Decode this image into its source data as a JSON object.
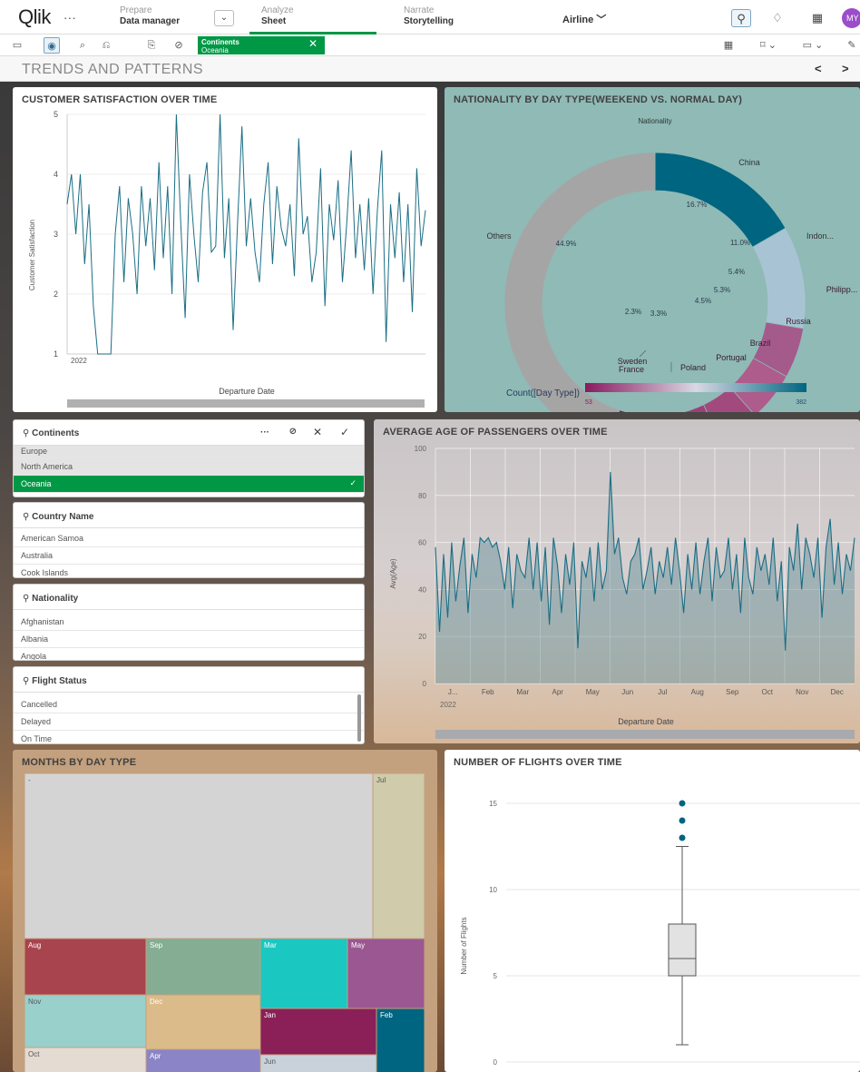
{
  "topbar": {
    "logo": "Qlik",
    "menu_dots": "···",
    "prepare_label": "Prepare",
    "prepare_value": "Data manager",
    "analyze_label": "Analyze",
    "analyze_value": "Sheet",
    "narrate_label": "Narrate",
    "narrate_value": "Storytelling",
    "app_name": "Airline",
    "avatar": "MY"
  },
  "selection": {
    "field": "Continents",
    "value": "Oceania"
  },
  "sheet": {
    "title": "TRENDS AND PATTERNS"
  },
  "panels": {
    "satisfaction": {
      "title": "CUSTOMER SATISFACTION OVER TIME",
      "ylabel": "Customer Satisfaction",
      "xlabel": "Departure Date",
      "x_tick": "2022",
      "y_ticks": [
        "1",
        "2",
        "3",
        "4",
        "5"
      ]
    },
    "nationality": {
      "title": "NATIONALITY BY DAY TYPE(WEEKEND VS. NORMAL DAY)",
      "legend_title": "Nationality",
      "color_legend": "Count([Day Type])",
      "color_min": "53",
      "color_max": "382"
    },
    "age": {
      "title": "AVERAGE AGE OF PASSENGERS OVER TIME",
      "ylabel": "Avg(Age)",
      "xlabel": "Departure Date",
      "year": "2022",
      "x_ticks": [
        "J...",
        "Feb",
        "Mar",
        "Apr",
        "May",
        "Jun",
        "Jul",
        "Aug",
        "Sep",
        "Oct",
        "Nov",
        "Dec"
      ],
      "y_ticks": [
        "0",
        "20",
        "40",
        "60",
        "80",
        "100"
      ]
    },
    "months": {
      "title": "MONTHS BY DAY TYPE"
    },
    "flights": {
      "title": "NUMBER OF FLIGHTS OVER TIME",
      "ylabel": "Number of Flights",
      "y_ticks": [
        "0",
        "5",
        "10",
        "15"
      ]
    }
  },
  "listboxes": {
    "continents": {
      "title": "Continents",
      "items": [
        "Europe",
        "North America",
        "Oceania"
      ]
    },
    "country": {
      "title": "Country Name",
      "items": [
        "American Samoa",
        "Australia",
        "Cook Islands"
      ]
    },
    "nationality": {
      "title": "Nationality",
      "items": [
        "Afghanistan",
        "Albania",
        "Angola"
      ]
    },
    "flight_status": {
      "title": "Flight Status",
      "items": [
        "Cancelled",
        "Delayed",
        "On Time"
      ]
    }
  },
  "colors": {
    "accent": "#009845",
    "line": "#1a6e85",
    "donut_high": "#006580",
    "donut_low": "#8a1a5e"
  },
  "chart_data": [
    {
      "type": "line",
      "title": "CUSTOMER SATISFACTION OVER TIME",
      "xlabel": "Departure Date",
      "ylabel": "Customer Satisfaction",
      "ylim": [
        1,
        5
      ],
      "values": [
        3.5,
        4,
        3,
        4,
        2.5,
        3.5,
        1.8,
        1,
        1,
        1,
        1,
        3,
        3.8,
        2.2,
        3.6,
        3,
        2,
        3.8,
        2.8,
        3.6,
        2.4,
        4.2,
        2.6,
        3.8,
        2,
        5,
        3.2,
        1.6,
        4,
        3,
        2.2,
        3.7,
        4.2,
        2.7,
        2.8,
        5,
        2.6,
        3.6,
        1.4,
        3.2,
        4.8,
        2.8,
        3.6,
        2.7,
        2.2,
        3.5,
        4.2,
        2.5,
        3.8,
        3.1,
        2.8,
        3.5,
        2.3,
        4.6,
        3,
        3.3,
        2.2,
        2.7,
        4.1,
        1.8,
        3.5,
        2.9,
        3.9,
        2.2,
        3.2,
        4.4,
        2.6,
        3.5,
        2.4,
        3.6,
        2,
        3.4,
        4.4,
        1.2,
        3.5,
        2.6,
        3.7,
        2.2,
        3.5,
        1.7,
        4.1,
        2.8,
        3.4
      ]
    },
    {
      "type": "pie",
      "title": "NATIONALITY BY DAY TYPE(WEEKEND VS. NORMAL DAY)",
      "slices": [
        {
          "label": "China",
          "value": 16.7
        },
        {
          "label": "Indon...",
          "value": 11.0
        },
        {
          "label": "Philipp...",
          "value": 5.4
        },
        {
          "label": "Russia",
          "value": 5.3
        },
        {
          "label": "Brazil",
          "value": 4.5
        },
        {
          "label": "Portugal",
          "value": 3.3
        },
        {
          "label": "Poland",
          "value": 3.3
        },
        {
          "label": "France",
          "value": 2.3
        },
        {
          "label": "Sweden",
          "value": 3.3
        },
        {
          "label": "Others",
          "value": 44.9
        }
      ],
      "slice_labels": [
        "16.7%",
        "11.0%",
        "5.4%",
        "5.3%",
        "4.5%",
        "3.3%",
        "2.3%",
        "44.9%"
      ]
    },
    {
      "type": "area",
      "title": "AVERAGE AGE OF PASSENGERS OVER TIME",
      "xlabel": "Departure Date",
      "ylabel": "Avg(Age)",
      "ylim": [
        0,
        100
      ],
      "categories": [
        "J...",
        "Feb",
        "Mar",
        "Apr",
        "May",
        "Jun",
        "Jul",
        "Aug",
        "Sep",
        "Oct",
        "Nov",
        "Dec"
      ],
      "values": [
        58,
        22,
        55,
        28,
        60,
        35,
        50,
        62,
        30,
        55,
        45,
        62,
        60,
        62,
        58,
        60,
        52,
        40,
        58,
        32,
        55,
        48,
        45,
        62,
        40,
        60,
        35,
        58,
        25,
        62,
        50,
        30,
        55,
        42,
        60,
        15,
        52,
        45,
        58,
        35,
        60,
        40,
        48,
        90,
        55,
        62,
        45,
        38,
        52,
        55,
        62,
        40,
        48,
        58,
        38,
        52,
        45,
        58,
        42,
        62,
        48,
        30,
        55,
        40,
        60,
        38,
        52,
        62,
        35,
        58,
        45,
        48,
        62,
        40,
        55,
        30,
        62,
        45,
        38,
        58,
        48,
        55,
        42,
        62,
        35,
        52,
        14,
        58,
        48,
        68,
        40,
        62,
        55,
        45,
        62,
        28,
        58,
        70,
        42,
        60,
        38,
        55,
        48,
        62
      ]
    },
    {
      "type": "heatmap",
      "title": "MONTHS BY DAY TYPE",
      "cells": [
        {
          "label": "-",
          "value": 53
        },
        {
          "label": "Jul",
          "value": 4
        },
        {
          "label": "Aug",
          "value": 4
        },
        {
          "label": "Sep",
          "value": 4
        },
        {
          "label": "Mar",
          "value": 3.5
        },
        {
          "label": "May",
          "value": 3.5
        },
        {
          "label": "Nov",
          "value": 3.5
        },
        {
          "label": "Dec",
          "value": 3
        },
        {
          "label": "Jan",
          "value": 3
        },
        {
          "label": "Feb",
          "value": 2.5
        },
        {
          "label": "Oct",
          "value": 3.5
        },
        {
          "label": "Apr",
          "value": 3
        },
        {
          "label": "Jun",
          "value": 3
        }
      ]
    },
    {
      "type": "box",
      "title": "NUMBER OF FLIGHTS OVER TIME",
      "ylabel": "Number of Flights",
      "ylim": [
        0,
        16
      ],
      "box": {
        "min": 1,
        "q1": 5,
        "median": 6,
        "q3": 8,
        "max": 12.5,
        "outliers": [
          13,
          14,
          15
        ]
      }
    }
  ]
}
